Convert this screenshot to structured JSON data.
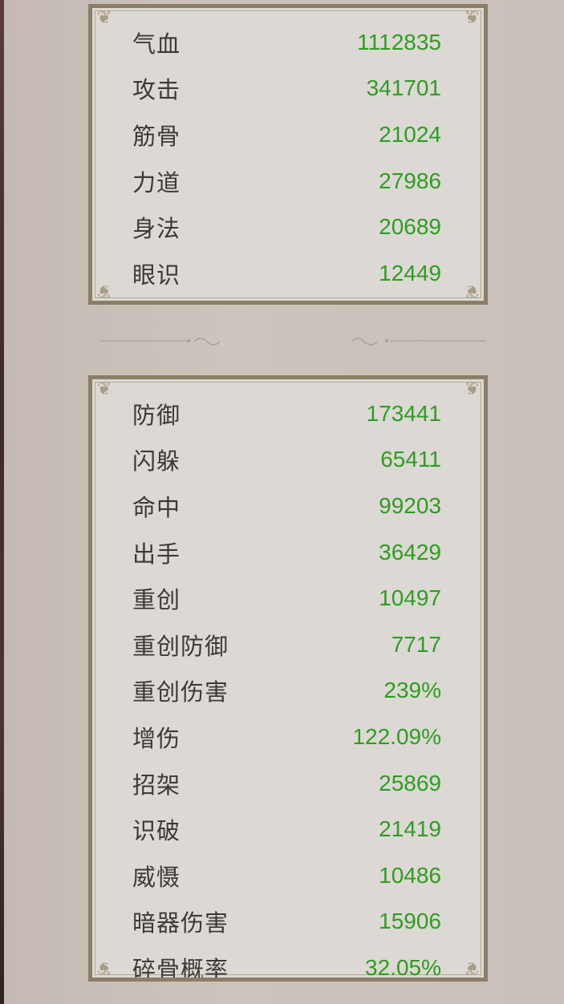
{
  "panel1": {
    "rows": [
      {
        "label": "气血",
        "value": "1112835"
      },
      {
        "label": "攻击",
        "value": "341701"
      },
      {
        "label": "筋骨",
        "value": "21024"
      },
      {
        "label": "力道",
        "value": "27986"
      },
      {
        "label": "身法",
        "value": "20689"
      },
      {
        "label": "眼识",
        "value": "12449"
      }
    ]
  },
  "panel2": {
    "rows": [
      {
        "label": "防御",
        "value": "173441"
      },
      {
        "label": "闪躲",
        "value": "65411"
      },
      {
        "label": "命中",
        "value": "99203"
      },
      {
        "label": "出手",
        "value": "36429"
      },
      {
        "label": "重创",
        "value": "10497"
      },
      {
        "label": "重创防御",
        "value": "7717"
      },
      {
        "label": "重创伤害",
        "value": "239%"
      },
      {
        "label": "增伤",
        "value": "122.09%"
      },
      {
        "label": "招架",
        "value": "25869"
      },
      {
        "label": "识破",
        "value": "21419"
      },
      {
        "label": "威慑",
        "value": "10486"
      },
      {
        "label": "暗器伤害",
        "value": "15906"
      },
      {
        "label": "碎骨概率",
        "value": "32.05%"
      }
    ]
  },
  "colors": {
    "value_green": "#2e9d22",
    "label_dark": "#3c3a36",
    "frame": "#8a7f66",
    "box_bg": "#dcd8d3",
    "page_bg": "#c9bfb8"
  },
  "icons": {
    "corner": "corner-flourish-icon",
    "divider": "ornamental-divider-icon"
  }
}
